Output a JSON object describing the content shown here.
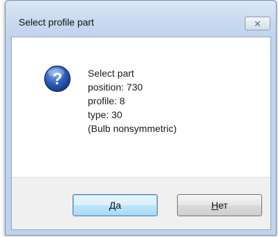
{
  "window": {
    "title": "Select profile part",
    "close_glyph": "✕"
  },
  "message": {
    "icon": "question-icon",
    "lines": [
      "Select part",
      "position: 730",
      "profile: 8",
      "type: 30",
      "(Bulb nonsymmetric)"
    ]
  },
  "buttons": {
    "yes_label": "Да",
    "no_label": "Нет"
  },
  "colors": {
    "title_bar": "#c7d9ef",
    "icon_blue": "#2a5cb8",
    "default_button_border": "#3c7fb1",
    "footer": "#f0f0f0"
  }
}
